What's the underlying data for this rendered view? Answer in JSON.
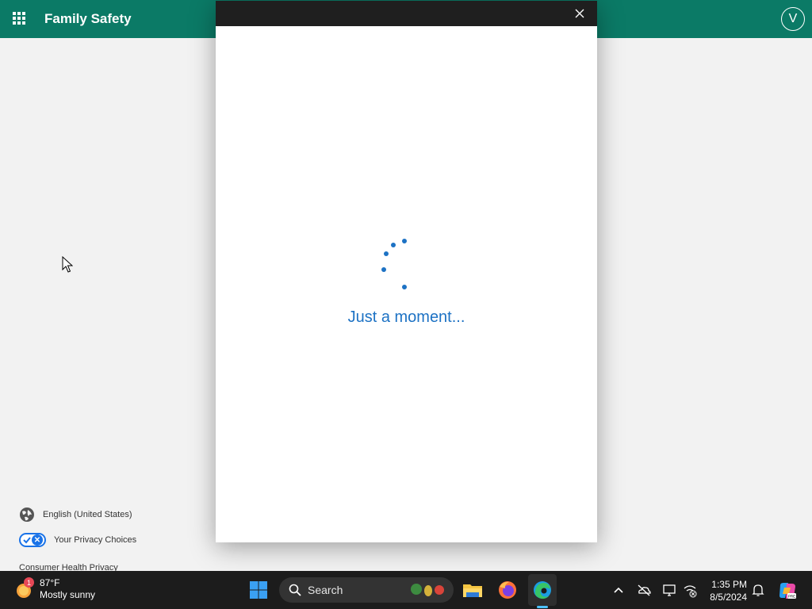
{
  "header": {
    "title": "Family Safety",
    "avatar_letter": "V"
  },
  "left_pane": {
    "language": "English (United States)",
    "privacy": "Your Privacy Choices",
    "health": "Consumer Health Privacy"
  },
  "modal": {
    "loading_text": "Just a moment..."
  },
  "taskbar": {
    "weather_temp": "87°F",
    "weather_desc": "Mostly sunny",
    "weather_badge": "1",
    "search_label": "Search",
    "time": "1:35 PM",
    "date": "8/5/2024"
  },
  "colors": {
    "header_bg": "#0b7a66",
    "taskbar_bg": "#1c1c1c",
    "accent_blue": "#1d72c4"
  }
}
